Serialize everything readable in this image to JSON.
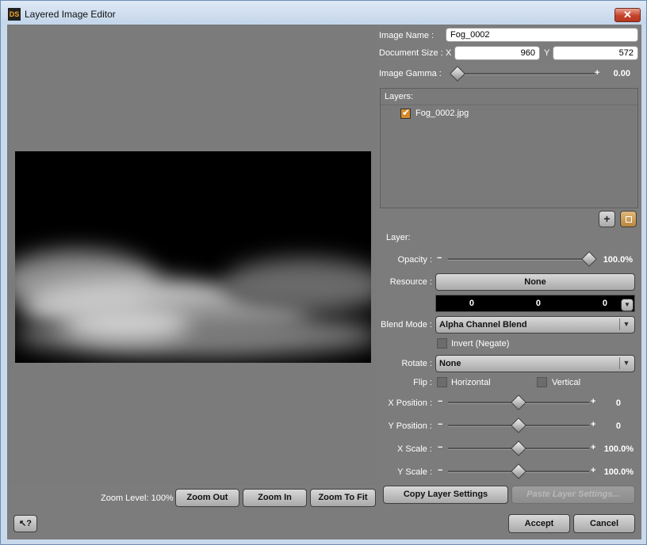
{
  "window": {
    "title": "Layered Image Editor",
    "app_icon": "DS",
    "close_symbol": "✕"
  },
  "image": {
    "name_label": "Image Name :",
    "name_value": "Fog_0002",
    "size_label": "Document Size :",
    "x_label": "X",
    "x_value": "960",
    "y_label": "Y",
    "y_value": "572",
    "gamma_label": "Image Gamma :",
    "gamma_value": "0.00"
  },
  "layers": {
    "header": "Layers:",
    "items": [
      {
        "name": "Fog_0002.jpg",
        "checked": true
      }
    ],
    "add_symbol": "+"
  },
  "layer": {
    "section_label": "Layer:",
    "opacity_label": "Opacity :",
    "opacity_value": "100.0%",
    "resource_label": "Resource :",
    "resource_button": "None",
    "resource_values": [
      "0",
      "0",
      "0"
    ],
    "blend_label": "Blend Mode :",
    "blend_value": "Alpha Channel Blend",
    "invert_label": "Invert (Negate)",
    "rotate_label": "Rotate :",
    "rotate_value": "None",
    "flip_label": "Flip :",
    "flip_h_label": "Horizontal",
    "flip_v_label": "Vertical",
    "xpos_label": "X Position :",
    "xpos_value": "0",
    "ypos_label": "Y Position :",
    "ypos_value": "0",
    "xscale_label": "X Scale :",
    "xscale_value": "100.0%",
    "yscale_label": "Y Scale :",
    "yscale_value": "100.0%",
    "minus": "−",
    "plus": "+"
  },
  "zoom": {
    "label": "Zoom Level: 100%",
    "out": "Zoom Out",
    "in": "Zoom In",
    "fit": "Zoom To Fit"
  },
  "buttons": {
    "copy": "Copy Layer Settings",
    "paste": "Paste Layer Settings...",
    "accept": "Accept",
    "cancel": "Cancel",
    "help": "?"
  }
}
